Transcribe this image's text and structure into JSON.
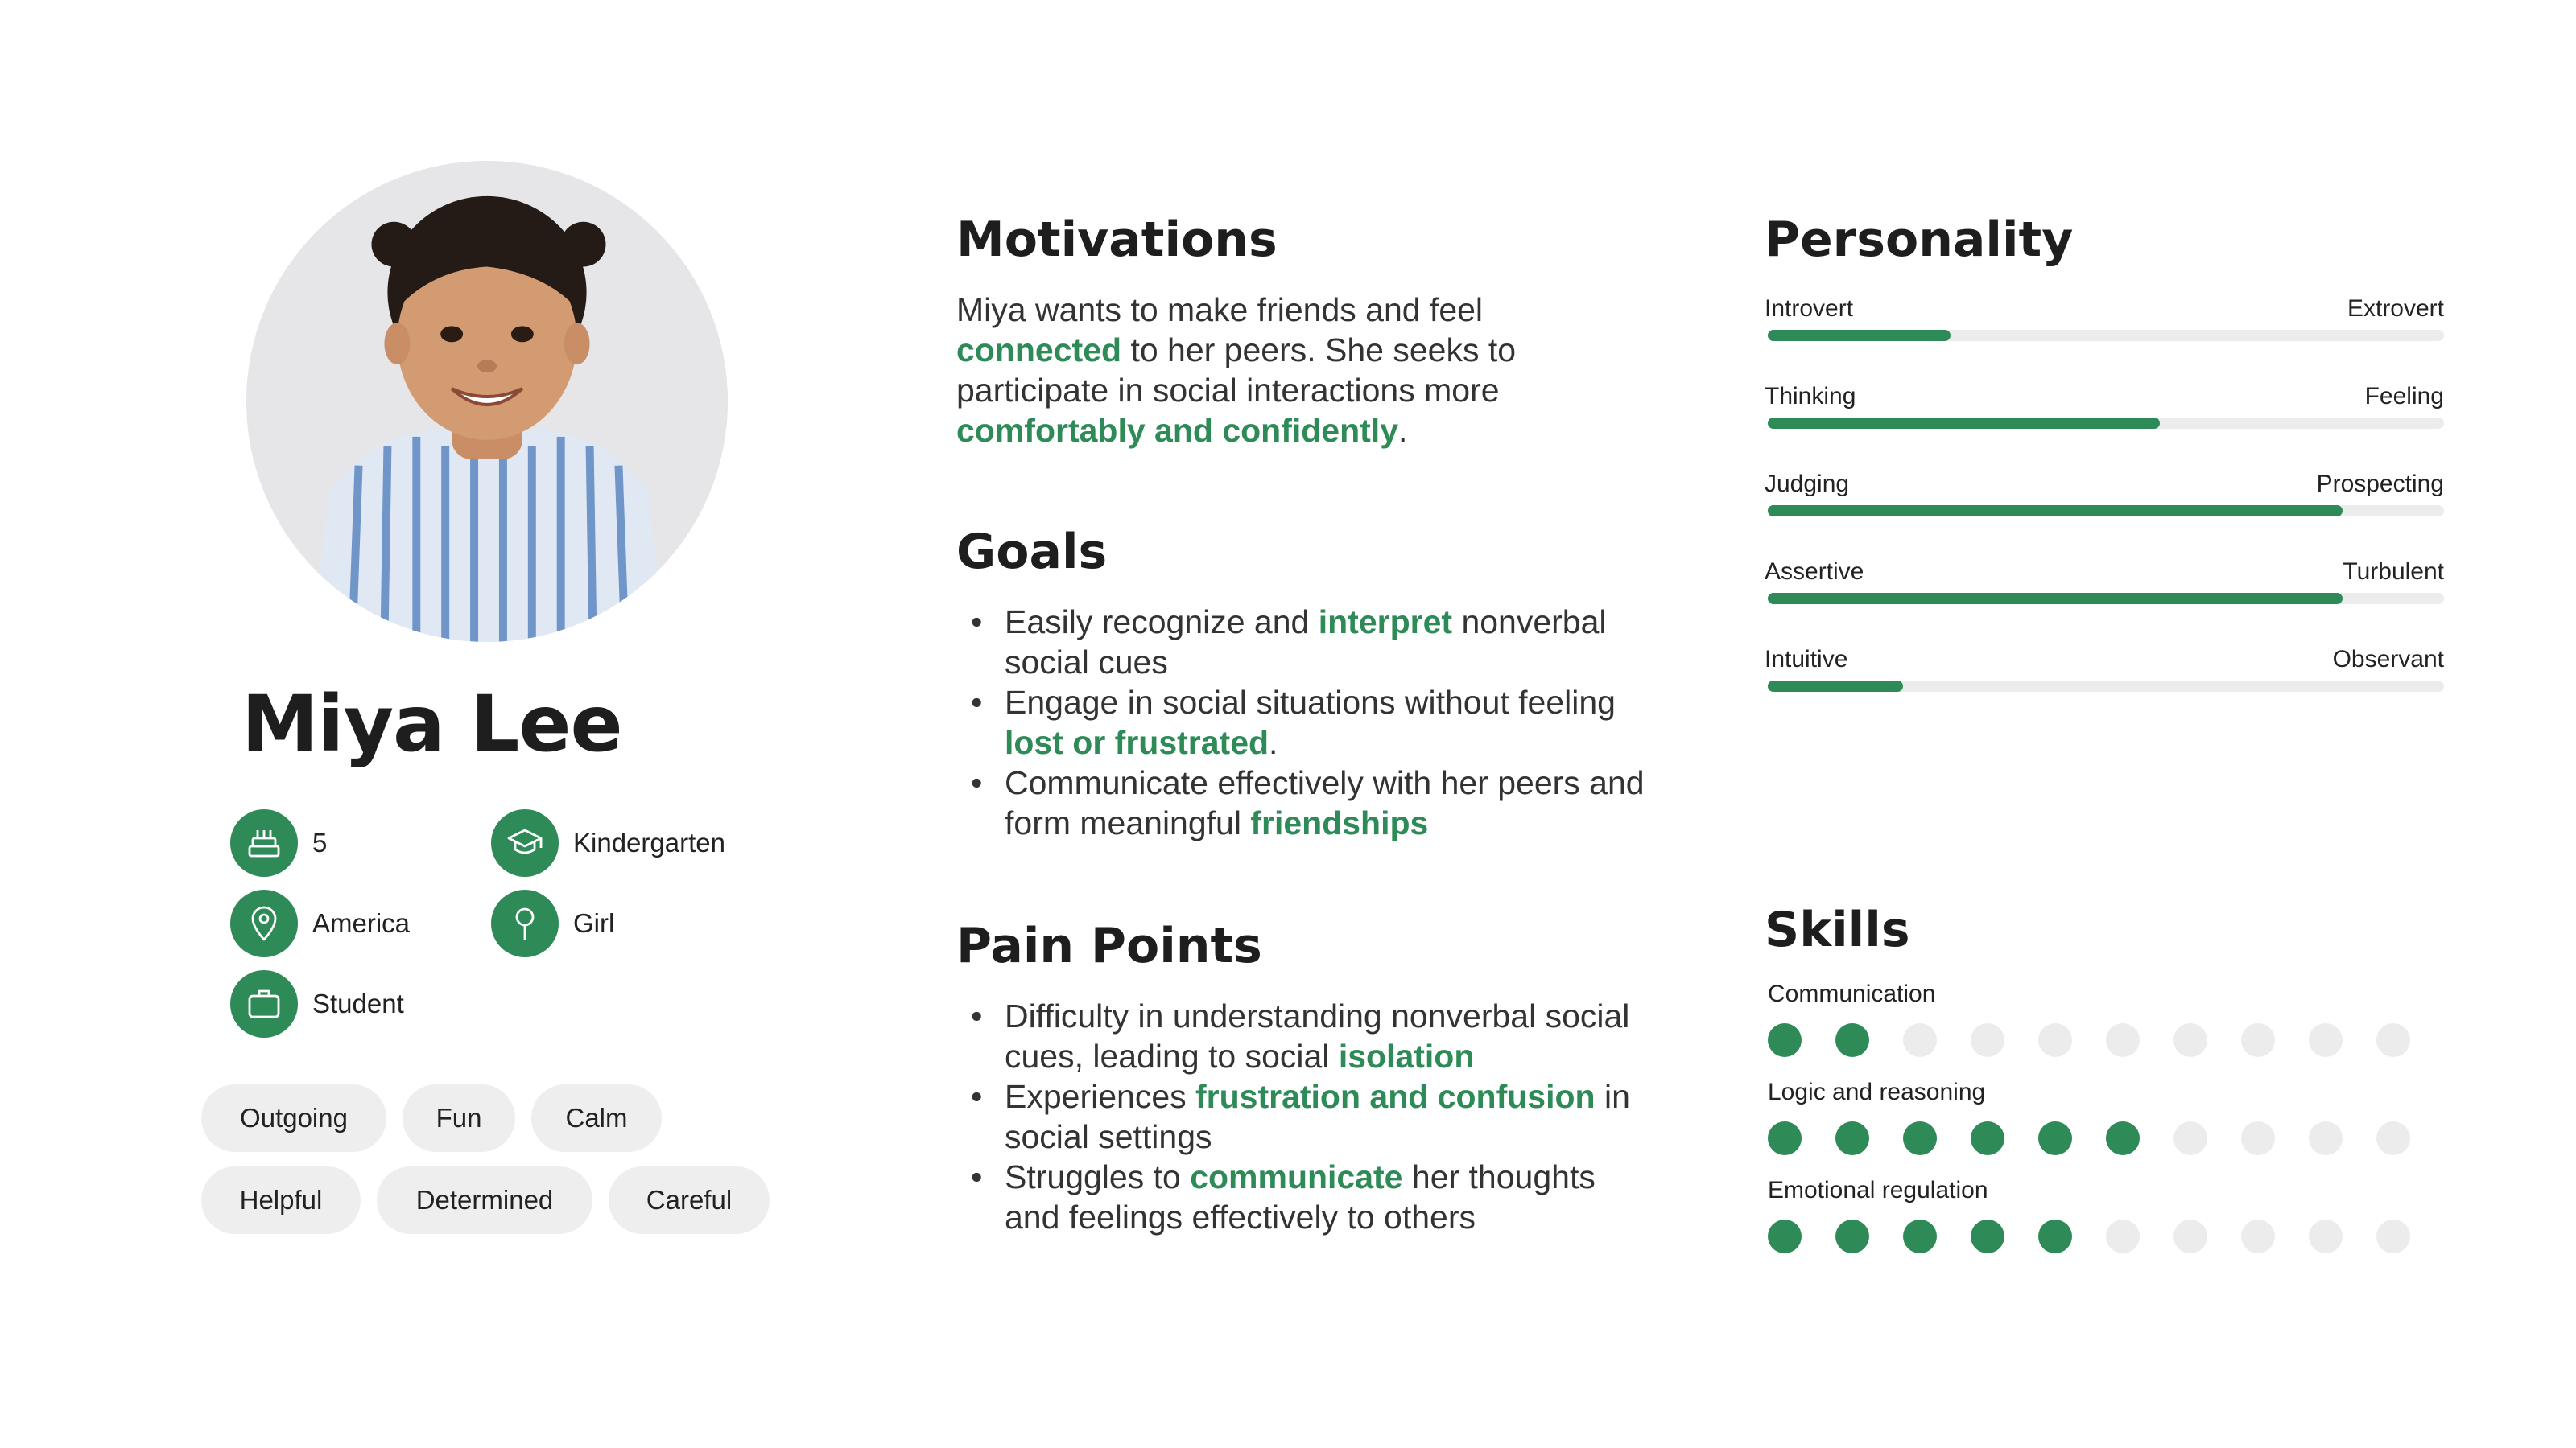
{
  "profile": {
    "name": "Miya Lee",
    "info": [
      {
        "icon": "birthday-cake-icon",
        "label": "5"
      },
      {
        "icon": "graduation-cap-icon",
        "label": "Kindergarten"
      },
      {
        "icon": "location-pin-icon",
        "label": "America"
      },
      {
        "icon": "gender-icon",
        "label": "Girl"
      },
      {
        "icon": "briefcase-icon",
        "label": "Student"
      }
    ],
    "tags": [
      "Outgoing",
      "Fun",
      "Calm",
      "Helpful",
      "Determined",
      "Careful"
    ]
  },
  "motivations": {
    "title": "Motivations",
    "parts": [
      {
        "t": "Miya wants to make friends and feel ",
        "hl": false
      },
      {
        "t": "connected",
        "hl": true
      },
      {
        "t": " to her peers. She seeks to participate in social interactions more ",
        "hl": false
      },
      {
        "t": "comfortably and confidently",
        "hl": true
      },
      {
        "t": ".",
        "hl": false
      }
    ]
  },
  "goals": {
    "title": "Goals",
    "items": [
      [
        {
          "t": "Easily recognize and ",
          "hl": false
        },
        {
          "t": "interpret",
          "hl": true
        },
        {
          "t": " nonverbal social cues",
          "hl": false
        }
      ],
      [
        {
          "t": "Engage in social situations without feeling ",
          "hl": false
        },
        {
          "t": "lost or frustrated",
          "hl": true
        },
        {
          "t": ".",
          "hl": false
        }
      ],
      [
        {
          "t": "Communicate effectively with her peers and form meaningful ",
          "hl": false
        },
        {
          "t": "friendships",
          "hl": true
        }
      ]
    ]
  },
  "pain_points": {
    "title": "Pain Points",
    "items": [
      [
        {
          "t": "Difficulty in understanding nonverbal social cues, leading to social ",
          "hl": false
        },
        {
          "t": "isolation",
          "hl": true
        }
      ],
      [
        {
          "t": "Experiences ",
          "hl": false
        },
        {
          "t": "frustration and confusion",
          "hl": true
        },
        {
          "t": " in social settings",
          "hl": false
        }
      ],
      [
        {
          "t": "Struggles to ",
          "hl": false
        },
        {
          "t": "communicate",
          "hl": true
        },
        {
          "t": " her thoughts and feelings effectively to others",
          "hl": false
        }
      ]
    ]
  },
  "personality": {
    "title": "Personality",
    "traits": [
      {
        "left": "Introvert",
        "right": "Extrovert",
        "level": 0.27
      },
      {
        "left": "Thinking",
        "right": "Feeling",
        "level": 0.58
      },
      {
        "left": "Judging",
        "right": "Prospecting",
        "level": 0.85
      },
      {
        "left": "Assertive",
        "right": "Turbulent",
        "level": 0.85
      },
      {
        "left": "Intuitive",
        "right": "Observant",
        "level": 0.2
      }
    ]
  },
  "skills": {
    "title": "Skills",
    "max": 10,
    "items": [
      {
        "label": "Communication",
        "level": 2
      },
      {
        "label": "Logic and reasoning",
        "level": 6
      },
      {
        "label": "Emotional regulation",
        "level": 5
      }
    ]
  },
  "colors": {
    "accent": "#2e8b57",
    "track": "#ececec",
    "tag_bg": "#eeeeee",
    "text": "#222222"
  }
}
